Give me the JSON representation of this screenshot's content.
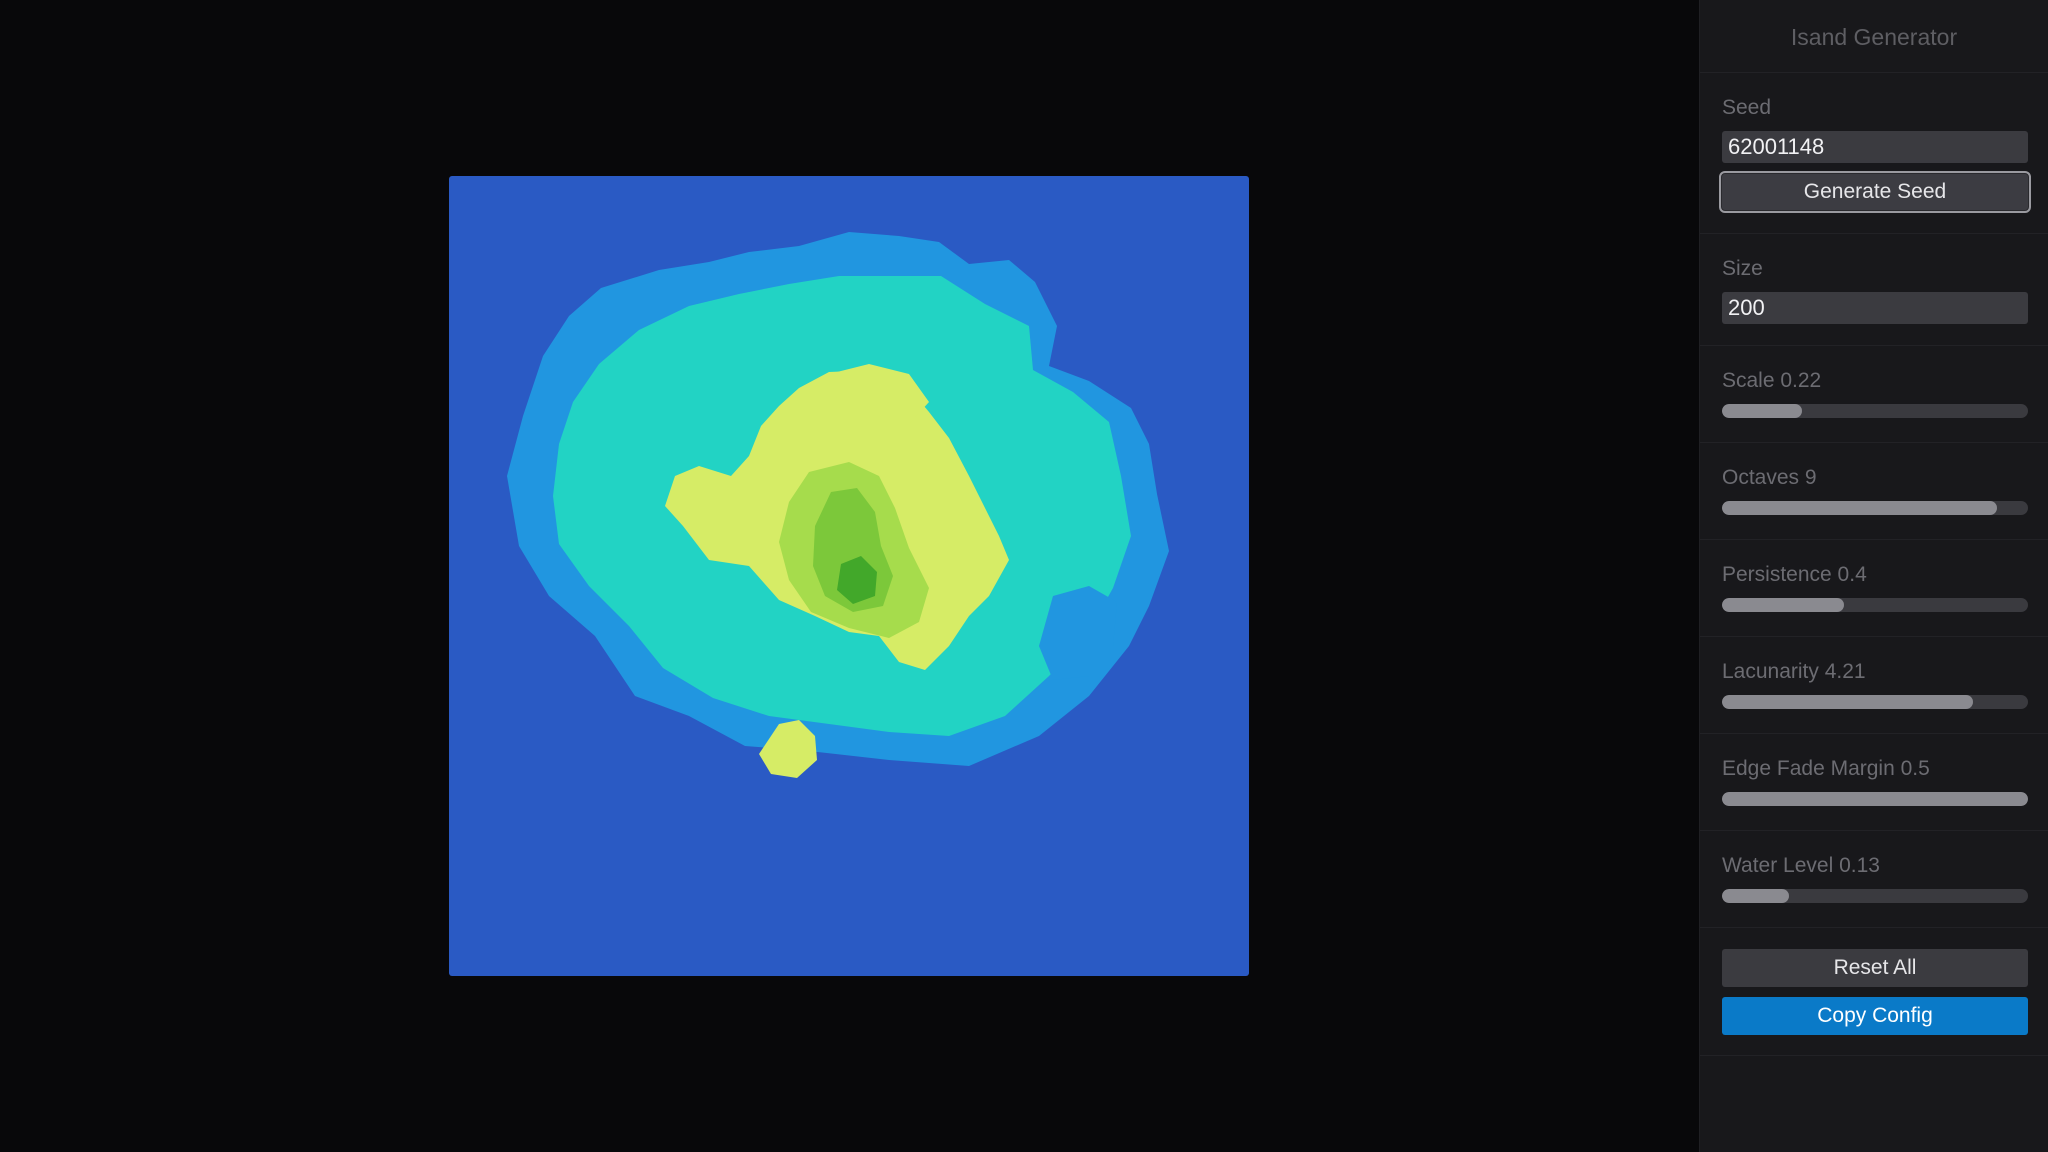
{
  "app": {
    "title": "Isand Generator"
  },
  "seed": {
    "label": "Seed",
    "value": "62001148",
    "generate_label": "Generate Seed"
  },
  "size": {
    "label": "Size",
    "value": "200"
  },
  "sliders": [
    {
      "label": "Scale 0.22",
      "fraction": 0.26
    },
    {
      "label": "Octaves 9",
      "fraction": 0.9
    },
    {
      "label": "Persistence 0.4",
      "fraction": 0.4
    },
    {
      "label": "Lacunarity 4.21",
      "fraction": 0.82
    },
    {
      "label": "Edge Fade Margin 0.5",
      "fraction": 1.0
    },
    {
      "label": "Water Level 0.13",
      "fraction": 0.22
    }
  ],
  "actions": {
    "reset_label": "Reset All",
    "copy_label": "Copy Config"
  },
  "colors": {
    "deep_water": "#2a5ac4",
    "shallow_water": "#2196e0",
    "lowland": "#22d3c4",
    "sand": "#d6ec66",
    "grass": "#a6dc4c",
    "forest": "#7cc83a",
    "peak": "#42a82a",
    "accent": "#0a7ac8"
  }
}
